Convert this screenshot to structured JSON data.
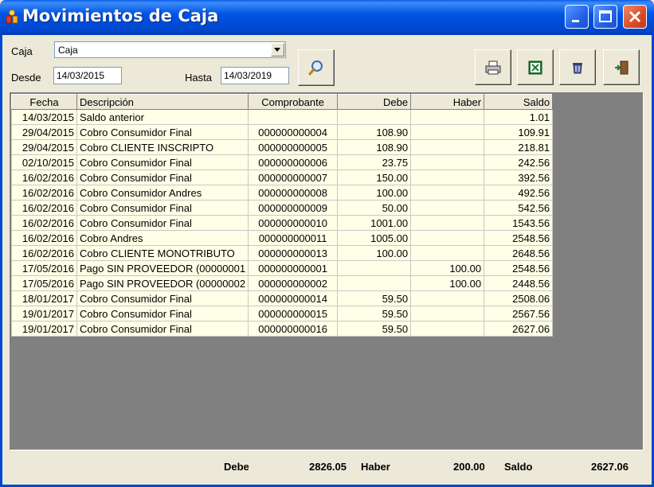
{
  "window": {
    "title": "Movimientos de Caja"
  },
  "filters": {
    "caja_label": "Caja",
    "caja_value": "Caja",
    "desde_label": "Desde",
    "desde_value": "14/03/2015",
    "hasta_label": "Hasta",
    "hasta_value": "14/03/2019"
  },
  "toolbar": {
    "search_icon": "magnifier-icon",
    "print_icon": "printer-icon",
    "excel_icon": "excel-icon",
    "clear_icon": "trash-icon",
    "exit_icon": "exit-door-icon"
  },
  "table": {
    "columns": [
      "Fecha",
      "Descripción",
      "Comprobante",
      "Debe",
      "Haber",
      "Saldo"
    ],
    "rows": [
      [
        "14/03/2015",
        "Saldo anterior",
        "",
        "",
        "",
        "1.01"
      ],
      [
        "29/04/2015",
        "Cobro Consumidor Final",
        "000000000004",
        "108.90",
        "",
        "109.91"
      ],
      [
        "29/04/2015",
        "Cobro CLIENTE INSCRIPTO",
        "000000000005",
        "108.90",
        "",
        "218.81"
      ],
      [
        "02/10/2015",
        "Cobro Consumidor Final",
        "000000000006",
        "23.75",
        "",
        "242.56"
      ],
      [
        "16/02/2016",
        "Cobro Consumidor Final",
        "000000000007",
        "150.00",
        "",
        "392.56"
      ],
      [
        "16/02/2016",
        "Cobro Consumidor Andres",
        "000000000008",
        "100.00",
        "",
        "492.56"
      ],
      [
        "16/02/2016",
        "Cobro Consumidor Final",
        "000000000009",
        "50.00",
        "",
        "542.56"
      ],
      [
        "16/02/2016",
        "Cobro Consumidor Final",
        "000000000010",
        "1001.00",
        "",
        "1543.56"
      ],
      [
        "16/02/2016",
        "Cobro Andres",
        "000000000011",
        "1005.00",
        "",
        "2548.56"
      ],
      [
        "16/02/2016",
        "Cobro CLIENTE MONOTRIBUTO",
        "000000000013",
        "100.00",
        "",
        "2648.56"
      ],
      [
        "17/05/2016",
        "Pago SIN PROVEEDOR (00000001",
        "000000000001",
        "",
        "100.00",
        "2548.56"
      ],
      [
        "17/05/2016",
        "Pago SIN PROVEEDOR (00000002",
        "000000000002",
        "",
        "100.00",
        "2448.56"
      ],
      [
        "18/01/2017",
        "Cobro Consumidor Final",
        "000000000014",
        "59.50",
        "",
        "2508.06"
      ],
      [
        "19/01/2017",
        "Cobro Consumidor Final",
        "000000000015",
        "59.50",
        "",
        "2567.56"
      ],
      [
        "19/01/2017",
        "Cobro Consumidor Final",
        "000000000016",
        "59.50",
        "",
        "2627.06"
      ]
    ]
  },
  "totals": {
    "debe_label": "Debe",
    "debe_value": "2826.05",
    "haber_label": "Haber",
    "haber_value": "200.00",
    "saldo_label": "Saldo",
    "saldo_value": "2627.06"
  }
}
